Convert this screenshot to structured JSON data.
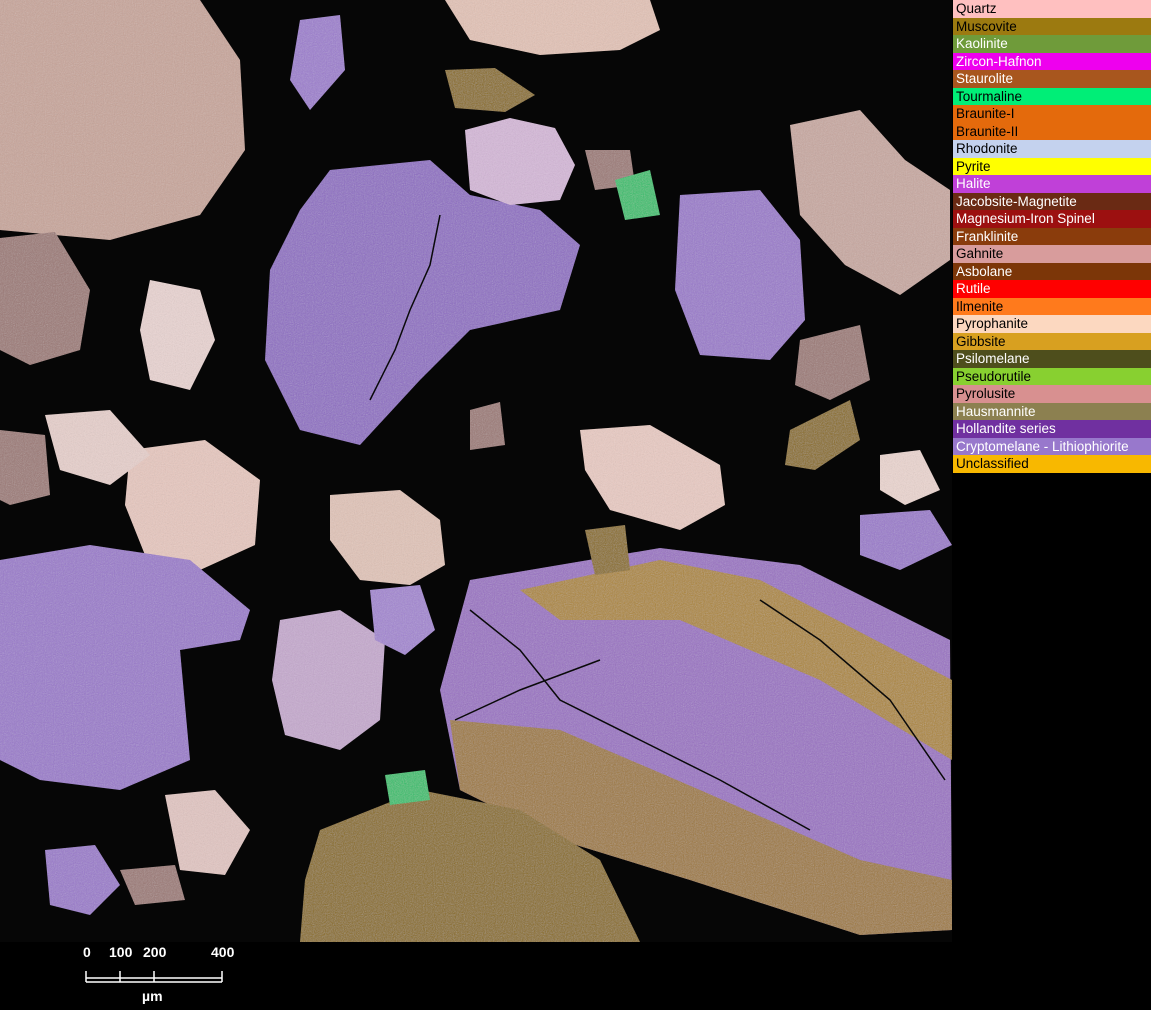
{
  "legend": {
    "items": [
      {
        "label": "Quartz",
        "color": "#ffc0c0",
        "text_color": "#000000"
      },
      {
        "label": "Muscovite",
        "color": "#9c7a10",
        "text_color": "#000000"
      },
      {
        "label": "Kaolinite",
        "color": "#6f9b3a",
        "text_color": "#ffffff"
      },
      {
        "label": "Zircon-Hafnon",
        "color": "#ee00ee",
        "text_color": "#ffffff"
      },
      {
        "label": "Staurolite",
        "color": "#a8561e",
        "text_color": "#ffffff"
      },
      {
        "label": "Tourmaline",
        "color": "#00ee77",
        "text_color": "#000000"
      },
      {
        "label": "Braunite-I",
        "color": "#e46a0c",
        "text_color": "#000000"
      },
      {
        "label": "Braunite-II",
        "color": "#e46a0c",
        "text_color": "#000000"
      },
      {
        "label": "Rhodonite",
        "color": "#c4d2ee",
        "text_color": "#000000"
      },
      {
        "label": "Pyrite",
        "color": "#ffff00",
        "text_color": "#000000"
      },
      {
        "label": "Halite",
        "color": "#c040d8",
        "text_color": "#ffffff"
      },
      {
        "label": "Jacobsite-Magnetite",
        "color": "#6a2a14",
        "text_color": "#ffffff"
      },
      {
        "label": "Magnesium-Iron Spinel",
        "color": "#9c1010",
        "text_color": "#ffffff"
      },
      {
        "label": "Franklinite",
        "color": "#8a3c0c",
        "text_color": "#ffffff"
      },
      {
        "label": "Gahnite",
        "color": "#d89c9c",
        "text_color": "#000000"
      },
      {
        "label": "Asbolane",
        "color": "#7c3608",
        "text_color": "#ffffff"
      },
      {
        "label": "Rutile",
        "color": "#ff0000",
        "text_color": "#ffffff"
      },
      {
        "label": "Ilmenite",
        "color": "#ff7a1c",
        "text_color": "#000000"
      },
      {
        "label": "Pyrophanite",
        "color": "#fcd8c0",
        "text_color": "#000000"
      },
      {
        "label": "Gibbsite",
        "color": "#d8a020",
        "text_color": "#000000"
      },
      {
        "label": "Psilomelane",
        "color": "#4e4e1c",
        "text_color": "#ffffff"
      },
      {
        "label": "Pseudorutile",
        "color": "#88d030",
        "text_color": "#000000"
      },
      {
        "label": "Pyrolusite",
        "color": "#d89090",
        "text_color": "#000000"
      },
      {
        "label": "Hausmannite",
        "color": "#8c8050",
        "text_color": "#ffffff"
      },
      {
        "label": "Hollandite series",
        "color": "#7030a0",
        "text_color": "#ffffff"
      },
      {
        "label": "Cryptomelane - Lithiophiorite",
        "color": "#9878cc",
        "text_color": "#ffffff"
      },
      {
        "label": "Unclassified",
        "color": "#f8b800",
        "text_color": "#000000"
      }
    ]
  },
  "scalebar": {
    "ticks": [
      {
        "label": "0",
        "value": 0
      },
      {
        "label": "100",
        "value": 100
      },
      {
        "label": "200",
        "value": 200
      },
      {
        "label": "400",
        "value": 400
      }
    ],
    "unit": "µm"
  }
}
